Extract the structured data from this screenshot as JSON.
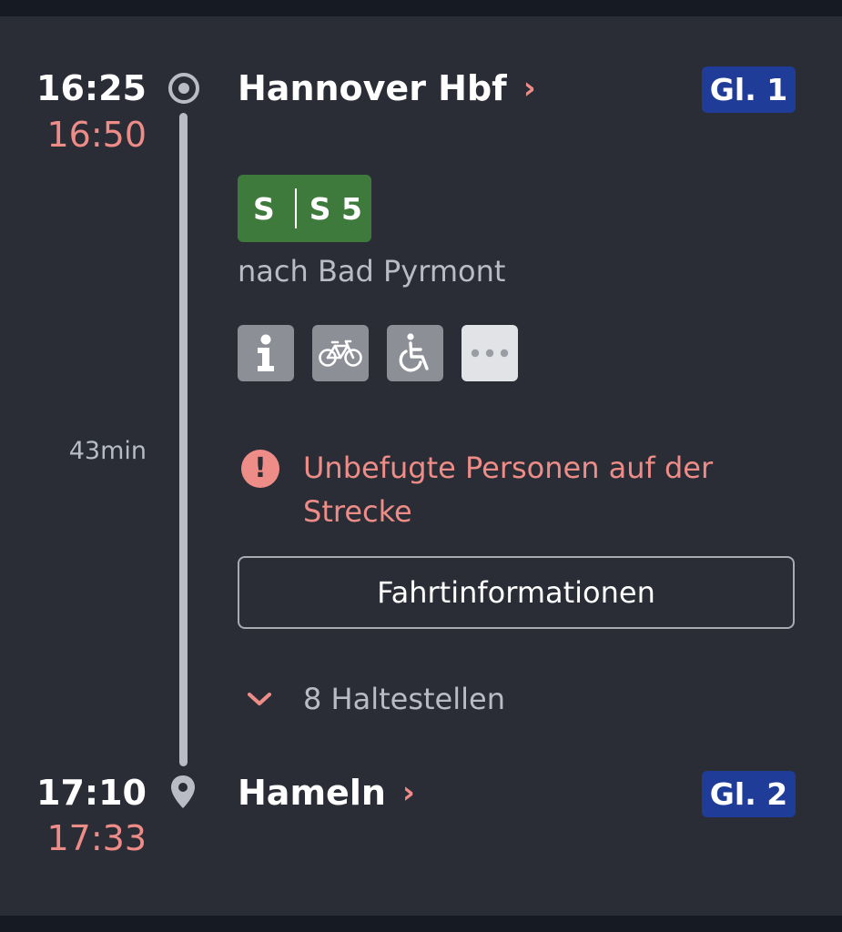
{
  "departure": {
    "scheduled_time": "16:25",
    "actual_time": "16:50",
    "station": "Hannover Hbf",
    "platform": "Gl. 1",
    "icon": "origin-circle-icon"
  },
  "arrival": {
    "scheduled_time": "17:10",
    "actual_time": "17:33",
    "station": "Hameln",
    "platform": "Gl. 2",
    "icon": "map-pin-icon"
  },
  "journey": {
    "duration": "43min",
    "product": "S",
    "line": "S 5",
    "direction": "nach Bad Pyrmont",
    "attributes": [
      "info-icon",
      "bicycle-icon",
      "wheelchair-icon",
      "more-icon"
    ]
  },
  "message": {
    "text": "Unbefugte Personen auf der Strecke",
    "icon": "alert-icon"
  },
  "actions": {
    "trip_info_label": "Fahrtinformationen",
    "stops_label": "8 Haltestellen"
  },
  "colors": {
    "background": "#2a2d36",
    "accent": "#ee8c88",
    "platform": "#1e3c98",
    "line_badge": "#3d7a3c"
  }
}
